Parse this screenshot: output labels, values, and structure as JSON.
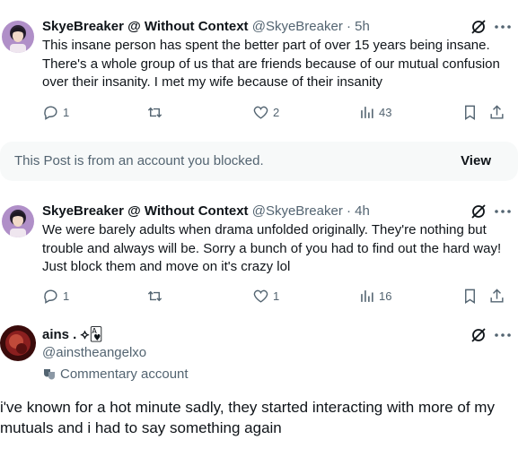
{
  "post1": {
    "author": "SkyeBreaker @ Without Context",
    "handle": "@SkyeBreaker",
    "time": "· 5h",
    "text": "This insane person has spent the better part of over 15 years being insane. There's a whole group of us that are friends because of our mutual confusion over their insanity. I met my wife because of their insanity",
    "replies": "1",
    "likes": "2",
    "views": "43"
  },
  "blocked": {
    "message": "This Post is from an account you blocked.",
    "view_label": "View"
  },
  "post2": {
    "author": "SkyeBreaker @ Without Context",
    "handle": "@SkyeBreaker",
    "time": "· 4h",
    "text": "We were barely adults when drama unfolded originally. They're nothing but trouble and always will be. Sorry a bunch of you had to find out the hard way! Just block them and move on it's crazy lol",
    "replies": "1",
    "likes": "1",
    "views": "16"
  },
  "reply": {
    "author": "ains . ⟡🂱",
    "handle": "@ainstheangelxo",
    "label": "Commentary account",
    "text": "i've known for a hot minute sadly, they started interacting with more of my mutuals and i had to say something again"
  },
  "icons": {
    "reply": "reply-icon",
    "retweet": "retweet-icon",
    "like": "heart-icon",
    "views": "views-icon",
    "bookmark": "bookmark-icon",
    "share": "share-icon",
    "grok": "grok-icon",
    "more": "more-icon"
  },
  "colors": {
    "text": "#0f1419",
    "secondary": "#536471",
    "blocked_bg": "#f7f9f9"
  }
}
